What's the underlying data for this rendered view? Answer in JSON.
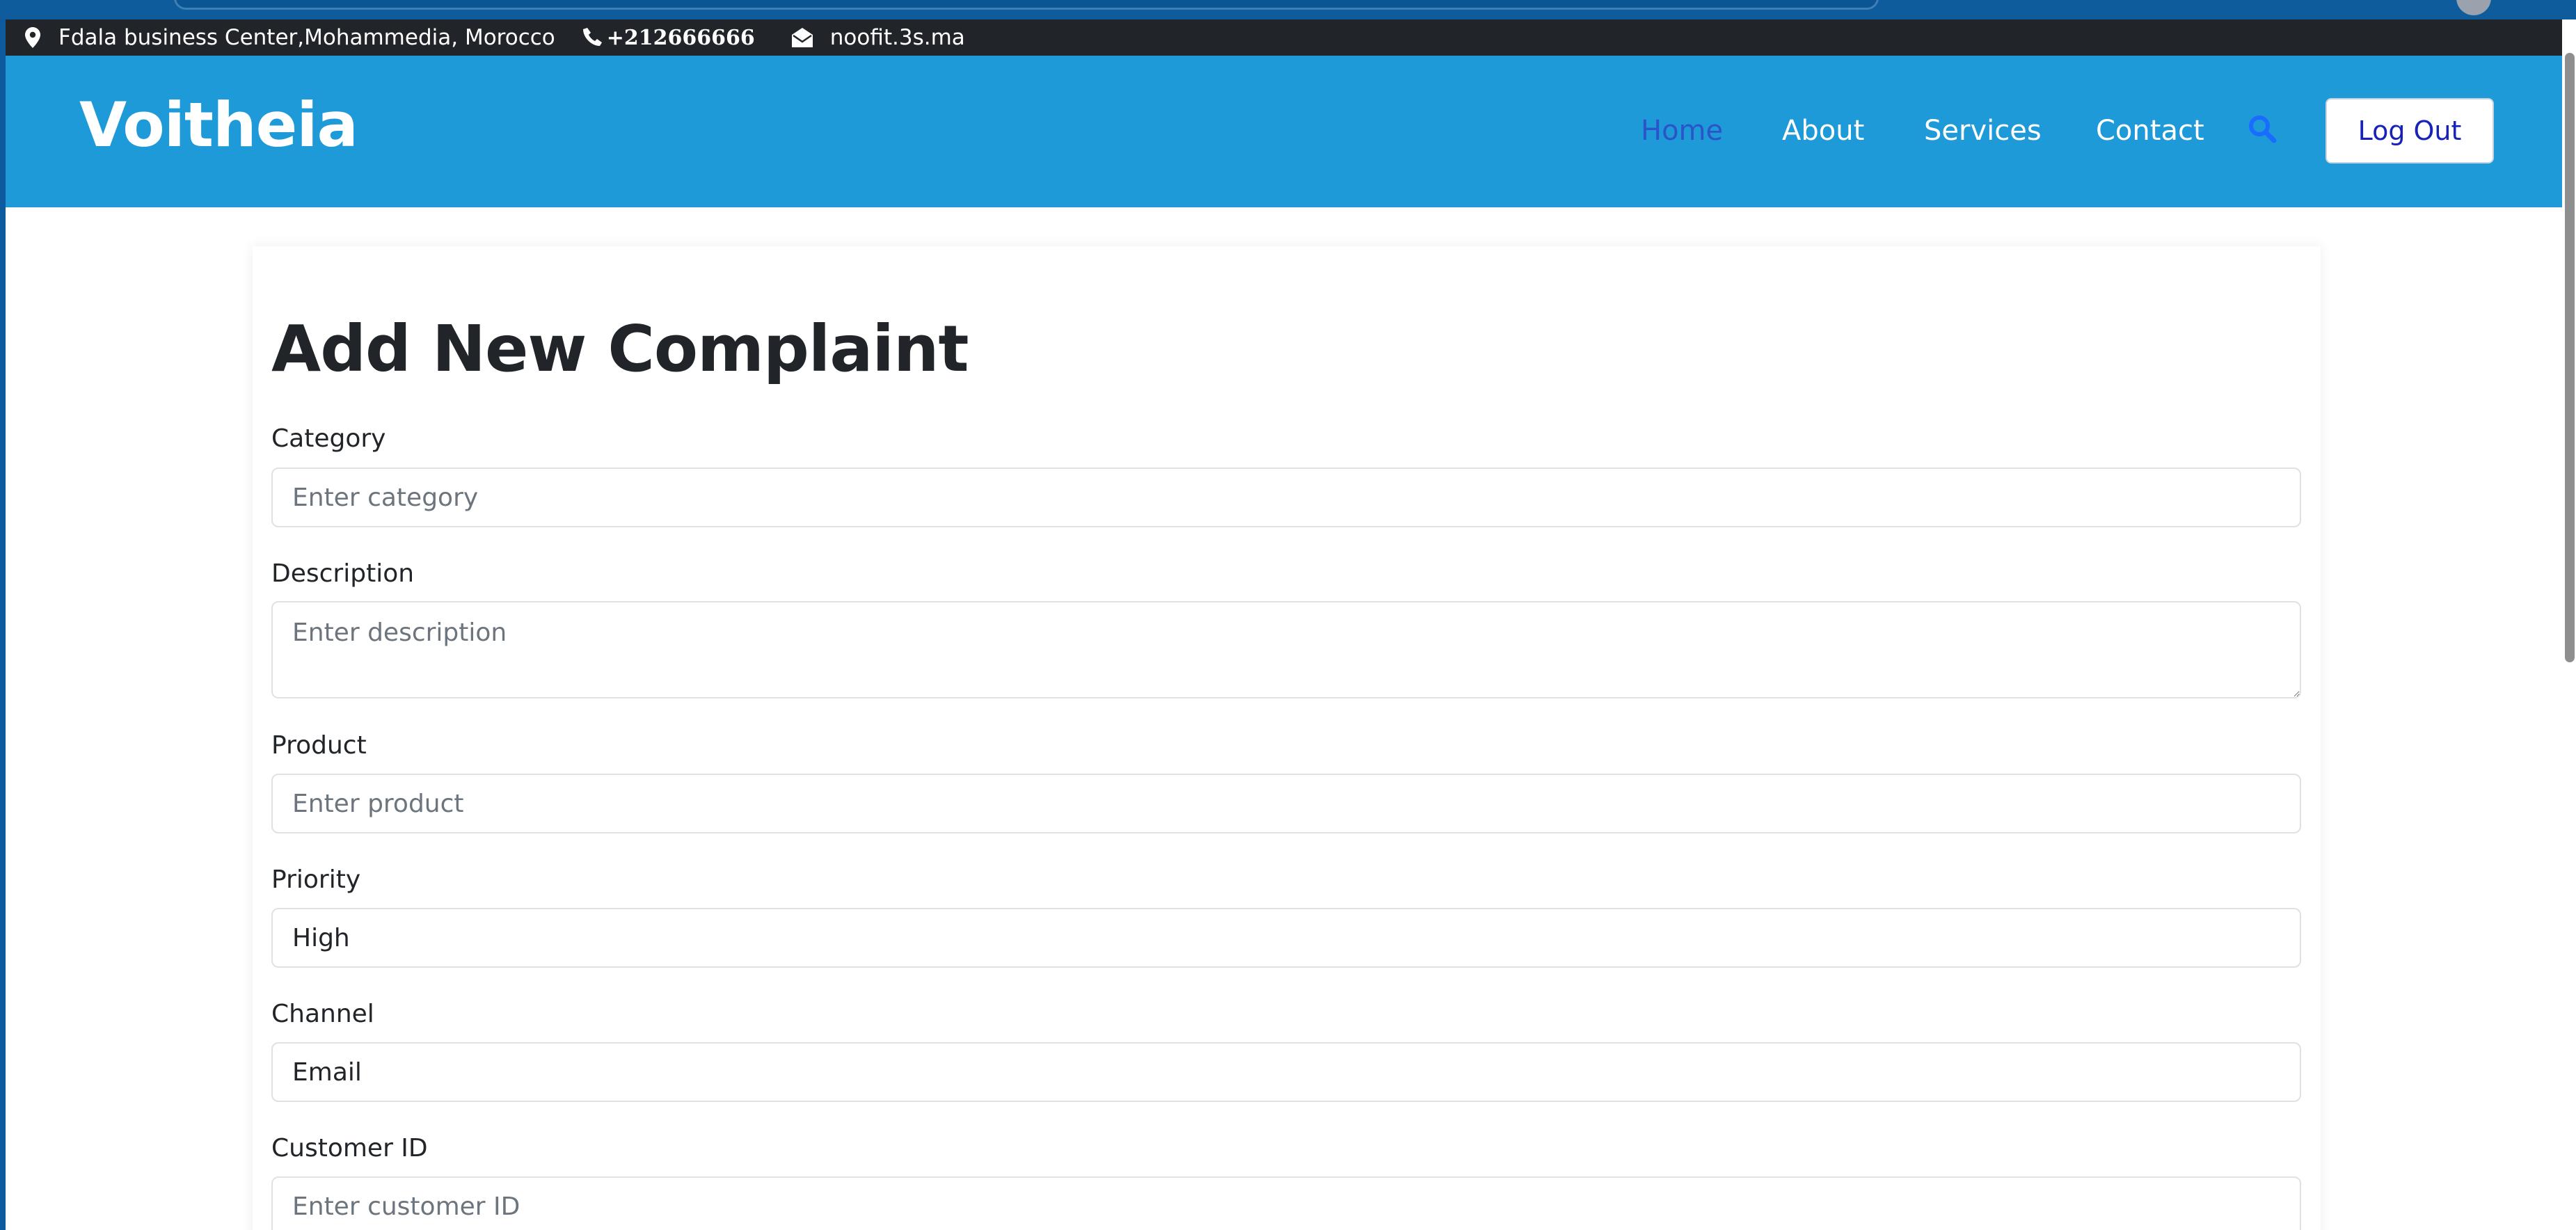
{
  "topbar": {
    "location": "Fdala business Center,Mohammedia, Morocco",
    "phone": "+212666666",
    "email": "noofit.3s.ma"
  },
  "navbar": {
    "brand": "Voitheia",
    "links": [
      {
        "label": "Home",
        "active": true
      },
      {
        "label": "About",
        "active": false
      },
      {
        "label": "Services",
        "active": false
      },
      {
        "label": "Contact",
        "active": false
      }
    ],
    "logout_label": "Log Out"
  },
  "form": {
    "title": "Add New Complaint",
    "fields": {
      "category": {
        "label": "Category",
        "placeholder": "Enter category",
        "value": ""
      },
      "description": {
        "label": "Description",
        "placeholder": "Enter description",
        "value": ""
      },
      "product": {
        "label": "Product",
        "placeholder": "Enter product",
        "value": ""
      },
      "priority": {
        "label": "Priority",
        "value": "High"
      },
      "channel": {
        "label": "Channel",
        "value": "Email"
      },
      "customer_id": {
        "label": "Customer ID",
        "placeholder": "Enter customer ID",
        "value": ""
      }
    }
  },
  "colors": {
    "navbar_bg": "#1e9ad9",
    "topbar_bg": "#212529",
    "active_link": "#2a55c9",
    "accent_search": "#1a6cff"
  },
  "icons": {
    "location": "map-pin-icon",
    "phone": "phone-icon",
    "email": "envelope-open-icon",
    "search": "search-icon"
  }
}
